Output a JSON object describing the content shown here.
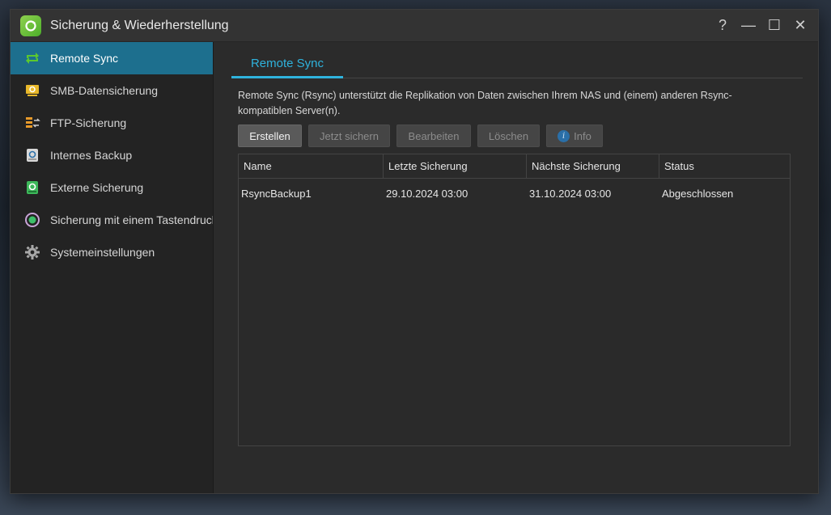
{
  "window": {
    "title": "Sicherung & Wiederherstellung",
    "controls": {
      "help": "?",
      "minimize": "—",
      "maximize": "☐",
      "close": "✕"
    }
  },
  "sidebar": {
    "items": [
      {
        "label": "Remote Sync",
        "icon": "remote-sync-icon",
        "active": true
      },
      {
        "label": "SMB-Datensicherung",
        "icon": "smb-backup-icon"
      },
      {
        "label": "FTP-Sicherung",
        "icon": "ftp-backup-icon"
      },
      {
        "label": "Internes Backup",
        "icon": "internal-backup-icon"
      },
      {
        "label": "Externe Sicherung",
        "icon": "external-backup-icon"
      },
      {
        "label": "Sicherung mit einem Tastendruck",
        "icon": "one-touch-backup-icon"
      },
      {
        "label": "Systemeinstellungen",
        "icon": "gear-icon"
      }
    ]
  },
  "main": {
    "tab": "Remote Sync",
    "description": "Remote Sync (Rsync) unterstützt die Replikation von Daten zwischen Ihrem NAS und (einem) anderen Rsync-kompatiblen Server(n).",
    "toolbar": {
      "create": "Erstellen",
      "backup_now": "Jetzt sichern",
      "edit": "Bearbeiten",
      "delete": "Löschen",
      "info": "Info"
    },
    "table": {
      "headers": [
        "Name",
        "Letzte Sicherung",
        "Nächste Sicherung",
        "Status"
      ],
      "rows": [
        [
          "RsyncBackup1",
          "29.10.2024 03:00",
          "31.10.2024 03:00",
          "Abgeschlossen"
        ]
      ]
    }
  },
  "colors": {
    "accent": "#2fb3dd",
    "active_nav": "#1d6f8e",
    "window_bg": "#2b2b2b"
  }
}
